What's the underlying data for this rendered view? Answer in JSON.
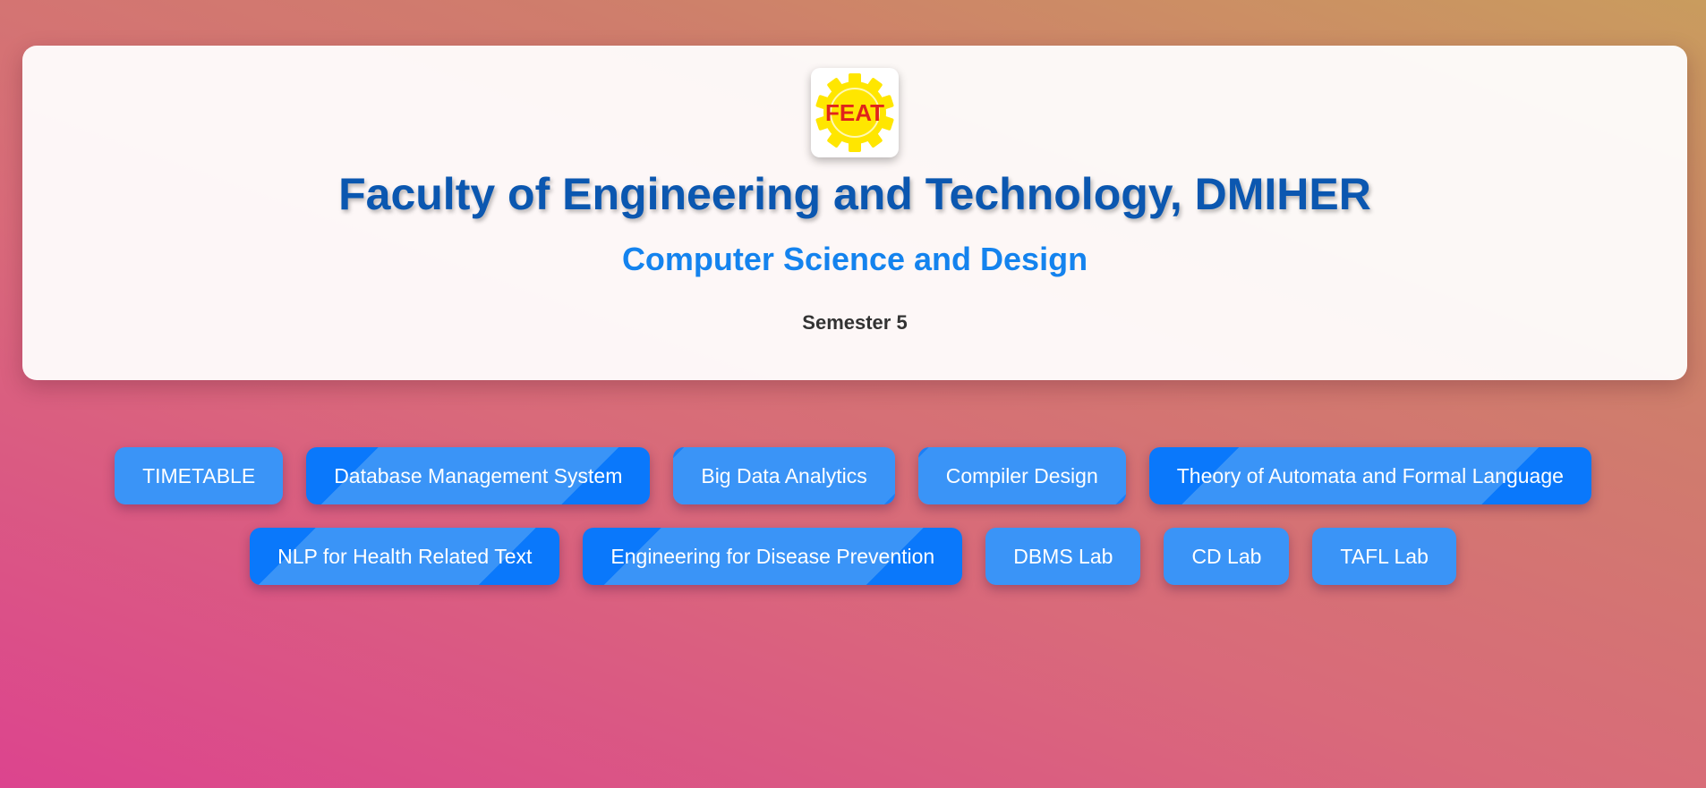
{
  "header": {
    "logo_text": "FEAT",
    "title": "Faculty of Engineering and Technology, DMIHER",
    "subtitle": "Computer Science and Design",
    "semester": "Semester 5"
  },
  "buttons": {
    "row1": [
      {
        "label": "TIMETABLE"
      },
      {
        "label": "Database Management System"
      },
      {
        "label": "Big Data Analytics"
      },
      {
        "label": "Compiler Design"
      },
      {
        "label": "Theory of Automata and Formal Language"
      }
    ],
    "row2": [
      {
        "label": "NLP for Health Related Text"
      },
      {
        "label": "Engineering for Disease Prevention"
      },
      {
        "label": "DBMS Lab"
      },
      {
        "label": "CD Lab"
      },
      {
        "label": "TAFL Lab"
      }
    ]
  },
  "colors": {
    "title": "#0b57b0",
    "subtitle": "#1483ee",
    "button": "#3a94f7",
    "button_accent": "#0a78fb",
    "logo_gear": "#ffe600",
    "logo_text": "#e0241b"
  }
}
